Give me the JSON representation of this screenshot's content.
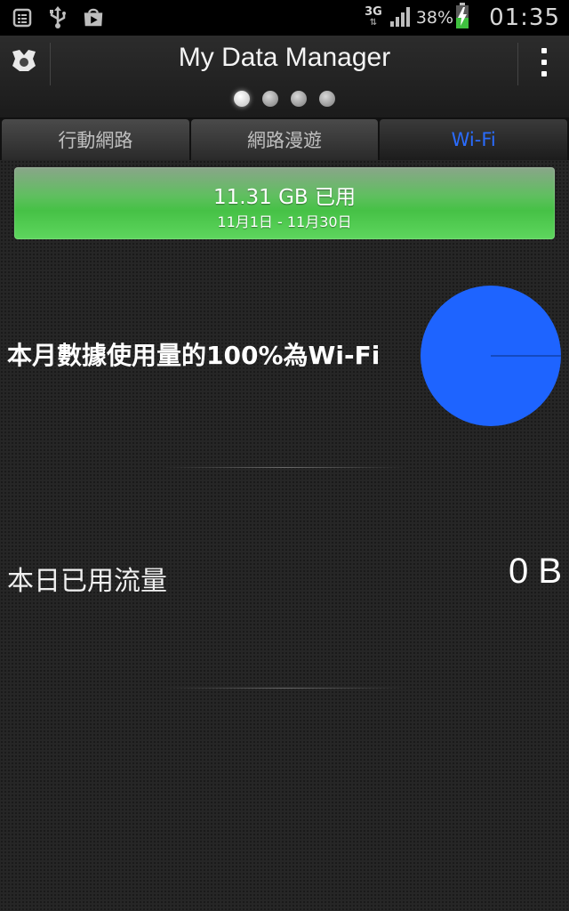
{
  "status_bar": {
    "network_type": "3G",
    "network_arrows": "⇅",
    "battery_percent": "38%",
    "time": "01:35",
    "icons": [
      "notes-icon",
      "usb-icon",
      "play-store-icon",
      "signal-icon",
      "battery-charging-icon"
    ]
  },
  "action_bar": {
    "title": "My Data Manager",
    "app_icon": "app-logo-icon",
    "menu_icon": "overflow-menu-icon",
    "page_indicator": {
      "count": 4,
      "active_index": 0
    }
  },
  "tabs": [
    {
      "label": "行動網路",
      "active": false
    },
    {
      "label": "網路漫遊",
      "active": false
    },
    {
      "label": "Wi-Fi",
      "active": true
    }
  ],
  "usage": {
    "amount": "11.31 GB 已用",
    "period": "11月1日 - 11月30日"
  },
  "pie": {
    "label": "本月數據使用量的100%為Wi-Fi",
    "wifi_fraction": 1.0,
    "color": "#1e64ff"
  },
  "today": {
    "label": "本日已用流量",
    "value": "0 B"
  },
  "colors": {
    "accent": "#2a6cff",
    "usage_bar": "#46c146"
  }
}
